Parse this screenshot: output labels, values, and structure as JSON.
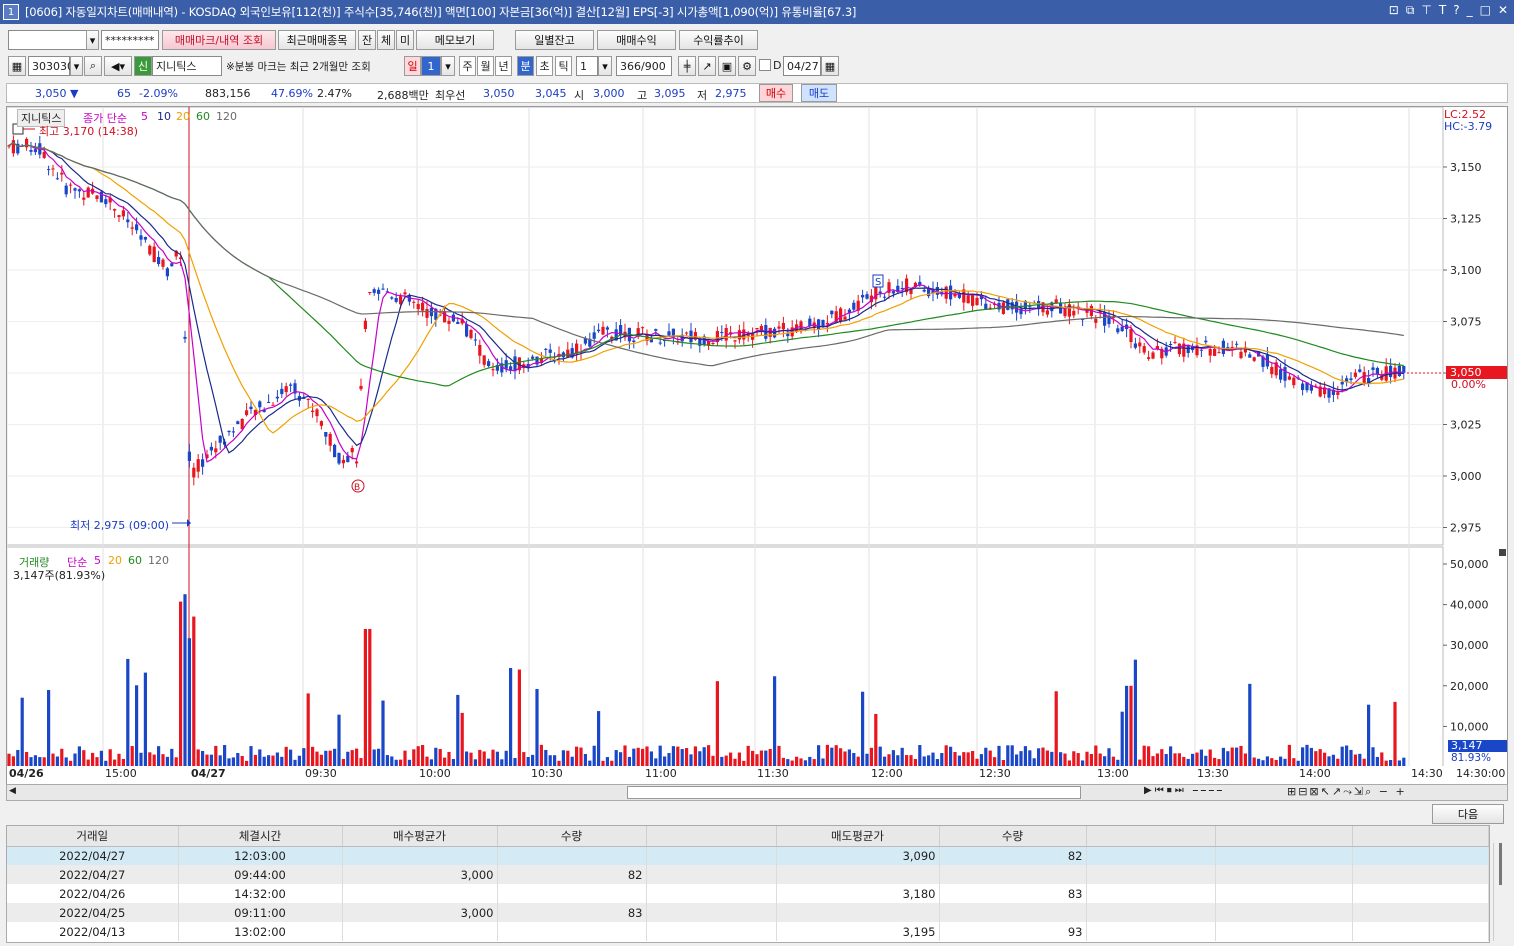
{
  "window": {
    "num": "1",
    "title": "[0606] 자동일지차트(매매내역) - KOSDAQ 외국인보유[112(천)] 주식수[35,746(천)] 액면[100] 자본금[36(억)] 결산[12월] EPS[-3] 시가총액[1,090(억)] 유통비율[67.3]"
  },
  "toolbar1": {
    "account": "",
    "password": "*********",
    "trade_mark": "매매마크/내역 조회",
    "recent": "최근매매종목",
    "btn_jan": "잔",
    "btn_che": "체",
    "btn_mi": "미",
    "memo": "메모보기",
    "daily": "일별잔고",
    "profit": "매매수익",
    "returns": "수익률추이"
  },
  "toolbar2": {
    "code": "303030",
    "tag": "신",
    "name": "지니틱스",
    "note": "※분봉 마크는 최근 2개월만 조회",
    "p_day": "일",
    "interval": "1",
    "p_week": "주",
    "p_month": "월",
    "p_year": "년",
    "p_min": "분",
    "p_sec": "초",
    "p_tick": "틱",
    "unit": "1",
    "count": "366/900",
    "d_label": "D",
    "date": "04/27"
  },
  "quote": {
    "price": "3,050 ▼",
    "change": "65",
    "rate": "-2.09%",
    "volume": "883,156",
    "vol_rate": "47.69%",
    "turnover": "2.47%",
    "amount": "2,688백만",
    "best_label": "최우선",
    "ask": "3,050",
    "bid": "3,045",
    "open_label": "시",
    "open": "3,000",
    "high_label": "고",
    "high": "3,095",
    "low_label": "저",
    "low": "2,975",
    "buy": "매수",
    "sell": "매도"
  },
  "price_panel": {
    "name": "지니틱스",
    "ma_label": "종가 단순",
    "ma": [
      "5",
      "10",
      "20",
      "60",
      "120"
    ],
    "high_note": "최고 3,170 (14:38)",
    "low_note": "최저 2,975 (09:00)",
    "lc": "LC:2.52",
    "hc": "HC:-3.79",
    "cur_price": "3,050",
    "cur_pct": "0.00%",
    "mark_s": "S",
    "mark_b": "B",
    "y_ticks": [
      "3,150",
      "3,125",
      "3,100",
      "3,075",
      "3,050",
      "3,025",
      "3,000",
      "2,975"
    ]
  },
  "volume_panel": {
    "name": "거래량",
    "ma_label": "단순",
    "ma": [
      "5",
      "20",
      "60",
      "120"
    ],
    "cur": "3,147주(81.93%)",
    "cur_axis": "3,147",
    "cur_axis_pct": "81.93%",
    "y_ticks": [
      "50,000",
      "40,000",
      "30,000",
      "20,000",
      "10,000"
    ]
  },
  "x_axis": [
    "04/26",
    "15:00",
    "04/27",
    "09:30",
    "10:00",
    "10:30",
    "11:00",
    "11:30",
    "12:00",
    "12:30",
    "13:00",
    "13:30",
    "14:00",
    "14:30",
    "14:30:00"
  ],
  "grid": {
    "next": "다음",
    "headers": [
      "거래일",
      "체결시간",
      "매수평균가",
      "수량",
      "",
      "매도평균가",
      "수량",
      "",
      "",
      ""
    ],
    "rows": [
      [
        "2022/04/27",
        "12:03:00",
        "",
        "",
        "",
        "3,090",
        "82",
        "",
        "",
        ""
      ],
      [
        "2022/04/27",
        "09:44:00",
        "3,000",
        "82",
        "",
        "",
        "",
        "",
        "",
        ""
      ],
      [
        "2022/04/26",
        "14:32:00",
        "",
        "",
        "",
        "3,180",
        "83",
        "",
        "",
        ""
      ],
      [
        "2022/04/25",
        "09:11:00",
        "3,000",
        "83",
        "",
        "",
        "",
        "",
        "",
        ""
      ],
      [
        "2022/04/13",
        "13:02:00",
        "",
        "",
        "",
        "3,195",
        "93",
        "",
        "",
        ""
      ]
    ]
  },
  "colors": {
    "up": "#e8161e",
    "down": "#1a46c8",
    "ma5": "#c800c8",
    "ma10": "#1a2a8a",
    "ma20": "#f0a000",
    "ma60": "#208a20",
    "ma120": "#6a6a6a"
  }
}
